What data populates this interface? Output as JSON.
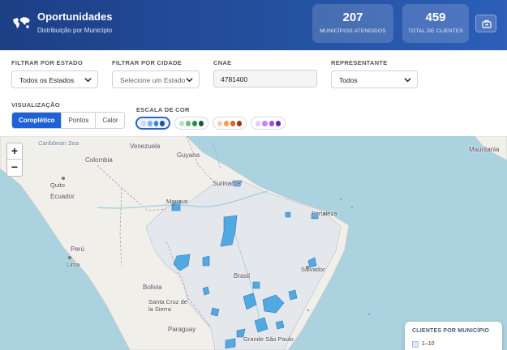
{
  "header": {
    "title": "Oportunidades",
    "subtitle": "Distribuição por Município",
    "stats": [
      {
        "value": "207",
        "label": "MUNICÍPIOS ATENDIDOS"
      },
      {
        "value": "459",
        "label": "TOTAL DE CLIENTES"
      }
    ]
  },
  "filters": {
    "estado": {
      "label": "FILTRAR POR ESTADO",
      "value": "Todos os Estados"
    },
    "cidade": {
      "label": "FILTRAR POR CIDADE",
      "placeholder": "Selecione um Estado"
    },
    "cnae": {
      "label": "CNAE",
      "value": "4781400"
    },
    "representante": {
      "label": "REPRESENTANTE",
      "value": "Todos"
    }
  },
  "visualization": {
    "label": "VISUALIZAÇÃO",
    "options": [
      "Coroplético",
      "Pontos",
      "Calor"
    ],
    "active": "Coroplético"
  },
  "color_scale": {
    "label": "ESCALA DE COR",
    "palettes": [
      {
        "name": "blue",
        "colors": [
          "#c6dbf5",
          "#7fb0ea",
          "#3b7fd9",
          "#1f4fa8"
        ],
        "active": true
      },
      {
        "name": "green",
        "colors": [
          "#b7e4c0",
          "#5ec27a",
          "#24934a",
          "#0f5e2b"
        ],
        "active": false
      },
      {
        "name": "orange",
        "colors": [
          "#fcd0a1",
          "#f49a55",
          "#df5f1f",
          "#9e3410"
        ],
        "active": false
      },
      {
        "name": "purple",
        "colors": [
          "#e3cdf7",
          "#c08af0",
          "#9a4fe0",
          "#6a25b3"
        ],
        "active": false
      }
    ]
  },
  "map": {
    "labels": {
      "venezuela": "Venezuela",
      "colombia": "Colombia",
      "guyana": "Guyana",
      "ecuador": "Ecuador",
      "quito": "Quito",
      "suriname": "Suriname",
      "manaus": "Manaus",
      "fortaleza": "Fortaleza",
      "peru": "Perú",
      "lima": "Lima",
      "brasil": "Brasil",
      "salvador": "Salvador",
      "bolivia": "Bolivia",
      "santa_cruz": "Santa Cruz de la Sierra",
      "paraguay": "Paraguay",
      "grande_sao_paulo": "Grande São Paulo",
      "mauritania": "Mauritania",
      "caribbean": "Caribbean Sea"
    },
    "zoom_in": "+",
    "zoom_out": "−"
  },
  "legend": {
    "title": "CLIENTES POR MUNICÍPIO",
    "items": [
      {
        "label": "1–10",
        "color": "#dfe9f8"
      }
    ]
  }
}
